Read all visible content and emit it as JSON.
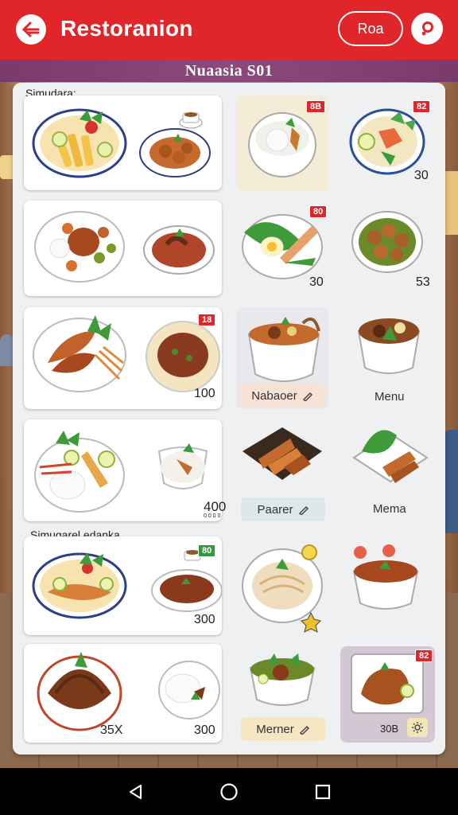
{
  "app": {
    "title": "Restoranion",
    "action_pill": "Roa"
  },
  "banner": {
    "text": "Nuaasia S01"
  },
  "sections": [
    {
      "label": "Simudara:"
    },
    {
      "label": "Simugarel edanka"
    }
  ],
  "prices": {
    "row1_right": "30",
    "row2_mid": "30",
    "row2_right": "53",
    "row3_left": "100",
    "row4_left": "400",
    "row4_left_sub": "0 0 0 0",
    "row5_left": "300",
    "row6_left_a": "35X",
    "row6_left_b": "300",
    "row6_right": "30B"
  },
  "badges": {
    "b1": "8B",
    "b2": "82",
    "b3": "80",
    "b4": "18",
    "b5": "80",
    "b6": "82"
  },
  "chips": {
    "c1": "Nabaoer",
    "c2": "Menu",
    "c3": "Paarer",
    "c4": "Mema",
    "c5": "Merner"
  },
  "colors": {
    "brand": "#e0262a",
    "banner": "#7a3a6a",
    "panel": "#eef0f2"
  },
  "nav": {
    "back": "back-icon",
    "home": "home-icon",
    "recents": "recents-icon"
  }
}
